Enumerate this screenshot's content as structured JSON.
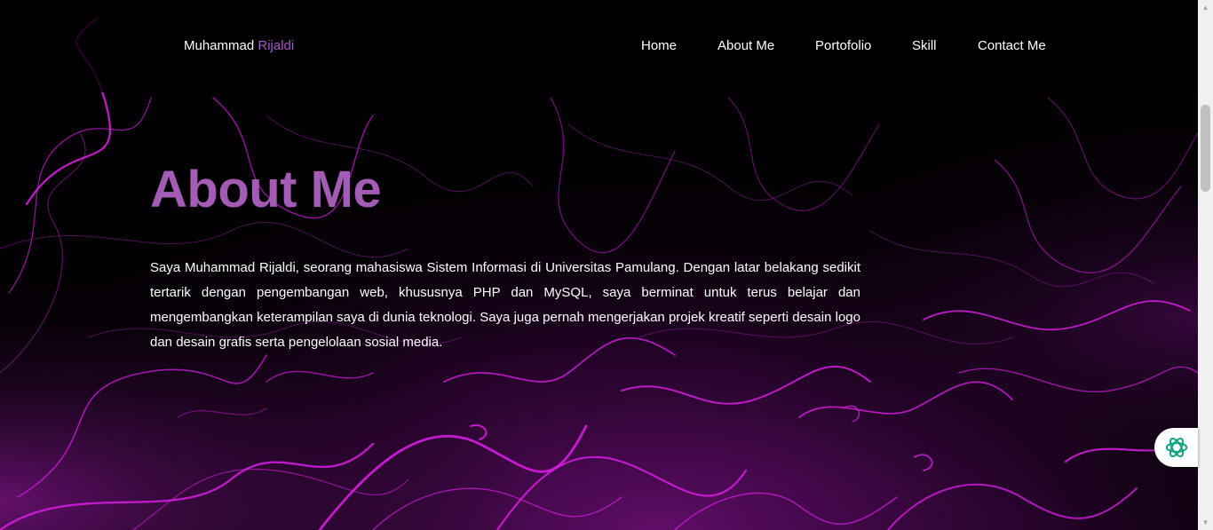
{
  "brand": {
    "first": "Muhammad",
    "last": "Rijaldi"
  },
  "nav": {
    "items": [
      {
        "label": "Home"
      },
      {
        "label": "About Me"
      },
      {
        "label": "Portofolio"
      },
      {
        "label": "Skill"
      },
      {
        "label": "Contact Me"
      }
    ]
  },
  "about": {
    "title": "About Me",
    "body": "Saya Muhammad Rijaldi, seorang mahasiswa Sistem Informasi di Universitas Pamulang. Dengan latar belakang sedikit tertarik dengan pengembangan web, khususnya PHP dan MySQL, saya berminat untuk terus belajar dan mengembangkan keterampilan saya di dunia teknologi. Saya juga pernah mengerjakan projek kreatif seperti desain logo dan desain grafis serta pengelolaan sosial media."
  },
  "widgets": {
    "assistant_icon": "ai-assistant-icon"
  },
  "colors": {
    "accent": "#a35cb3",
    "brand_accent": "#a855c7",
    "background": "#000000",
    "swirl": "#d61ee0",
    "assistant": "#10a37f"
  }
}
